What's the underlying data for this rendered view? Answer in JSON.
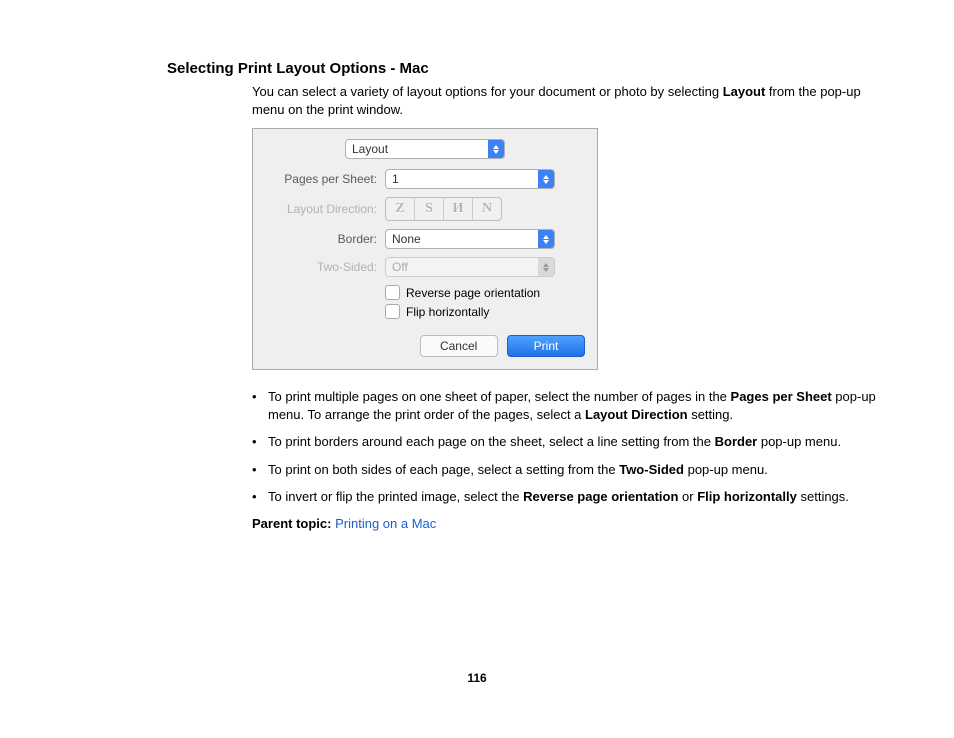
{
  "title": "Selecting Print Layout Options - Mac",
  "intro": {
    "pre": "You can select a variety of layout options for your document or photo by selecting ",
    "bold": "Layout",
    "post": " from the pop-up menu on the print window."
  },
  "dialog": {
    "topmenu": "Layout",
    "pages_per_sheet_label": "Pages per Sheet:",
    "pages_per_sheet_value": "1",
    "layout_direction_label": "Layout Direction:",
    "layout_direction_glyphs": [
      "Z",
      "S",
      "И",
      "N"
    ],
    "border_label": "Border:",
    "border_value": "None",
    "two_sided_label": "Two-Sided:",
    "two_sided_value": "Off",
    "reverse_label": "Reverse page orientation",
    "flip_label": "Flip horizontally",
    "cancel": "Cancel",
    "print": "Print"
  },
  "bullets": [
    {
      "parts": [
        {
          "t": "To print multiple pages on one sheet of paper, select the number of pages in the "
        },
        {
          "b": "Pages per Sheet"
        },
        {
          "t": " pop-up menu. To arrange the print order of the pages, select a "
        },
        {
          "b": "Layout Direction"
        },
        {
          "t": " setting."
        }
      ]
    },
    {
      "parts": [
        {
          "t": "To print borders around each page on the sheet, select a line setting from the "
        },
        {
          "b": "Border"
        },
        {
          "t": " pop-up menu."
        }
      ]
    },
    {
      "parts": [
        {
          "t": "To print on both sides of each page, select a setting from the "
        },
        {
          "b": "Two-Sided"
        },
        {
          "t": " pop-up menu."
        }
      ]
    },
    {
      "parts": [
        {
          "t": "To invert or flip the printed image, select the "
        },
        {
          "b": "Reverse page orientation"
        },
        {
          "t": " or "
        },
        {
          "b": "Flip horizontally"
        },
        {
          "t": " settings."
        }
      ]
    }
  ],
  "parent": {
    "label": "Parent topic:",
    "link": "Printing on a Mac"
  },
  "page_number": "116"
}
